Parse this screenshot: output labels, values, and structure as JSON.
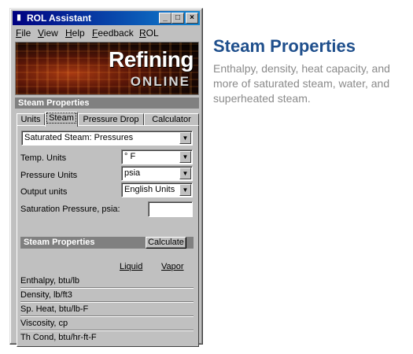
{
  "window": {
    "title": "ROL Assistant",
    "controls": {
      "minimize": "_",
      "maximize": "□",
      "close": "×"
    }
  },
  "menu": [
    {
      "label": "File",
      "key": "F",
      "rest": "ile"
    },
    {
      "label": "View",
      "key": "V",
      "rest": "iew"
    },
    {
      "label": "Help",
      "key": "H",
      "rest": "elp"
    },
    {
      "label": "Feedback",
      "key": "F",
      "rest": "eedback"
    },
    {
      "label": "ROL",
      "key": "R",
      "rest": "OL"
    }
  ],
  "banner": {
    "line1": "Refining",
    "line2": "ONLINE"
  },
  "section_header": "Steam Properties",
  "tabs": [
    {
      "label": "Units",
      "active": false
    },
    {
      "label": "Steam",
      "active": true
    },
    {
      "label": "Pressure Drop",
      "active": false
    },
    {
      "label": "Calculator",
      "active": false
    }
  ],
  "form": {
    "mode_select": "Saturated Steam: Pressures",
    "temp_units_label": "Temp. Units",
    "temp_units_value": "° F",
    "pressure_units_label": "Pressure Units",
    "pressure_units_value": "psia",
    "output_units_label": "Output units",
    "output_units_value": "English Units",
    "sat_pressure_label": "Saturation Pressure, psia:",
    "sat_pressure_value": ""
  },
  "results": {
    "header": "Steam Properties",
    "calculate_label": "Calculate",
    "col_liquid": "Liquid",
    "col_vapor": "Vapor",
    "rows": [
      "Enthalpy, btu/lb",
      "Density, lb/ft3",
      "Sp. Heat, btu/lb-F",
      "Viscosity, cp",
      "Th Cond, btu/hr-ft-F"
    ]
  },
  "side": {
    "title": "Steam Properties",
    "description": "Enthalpy, density, heat capacity, and more of saturated steam, water, and superheated steam."
  },
  "colors": {
    "titlebar": "#000080",
    "side_title": "#1f4f8c",
    "side_text": "#8a8a8a",
    "section_bar": "#808080"
  }
}
